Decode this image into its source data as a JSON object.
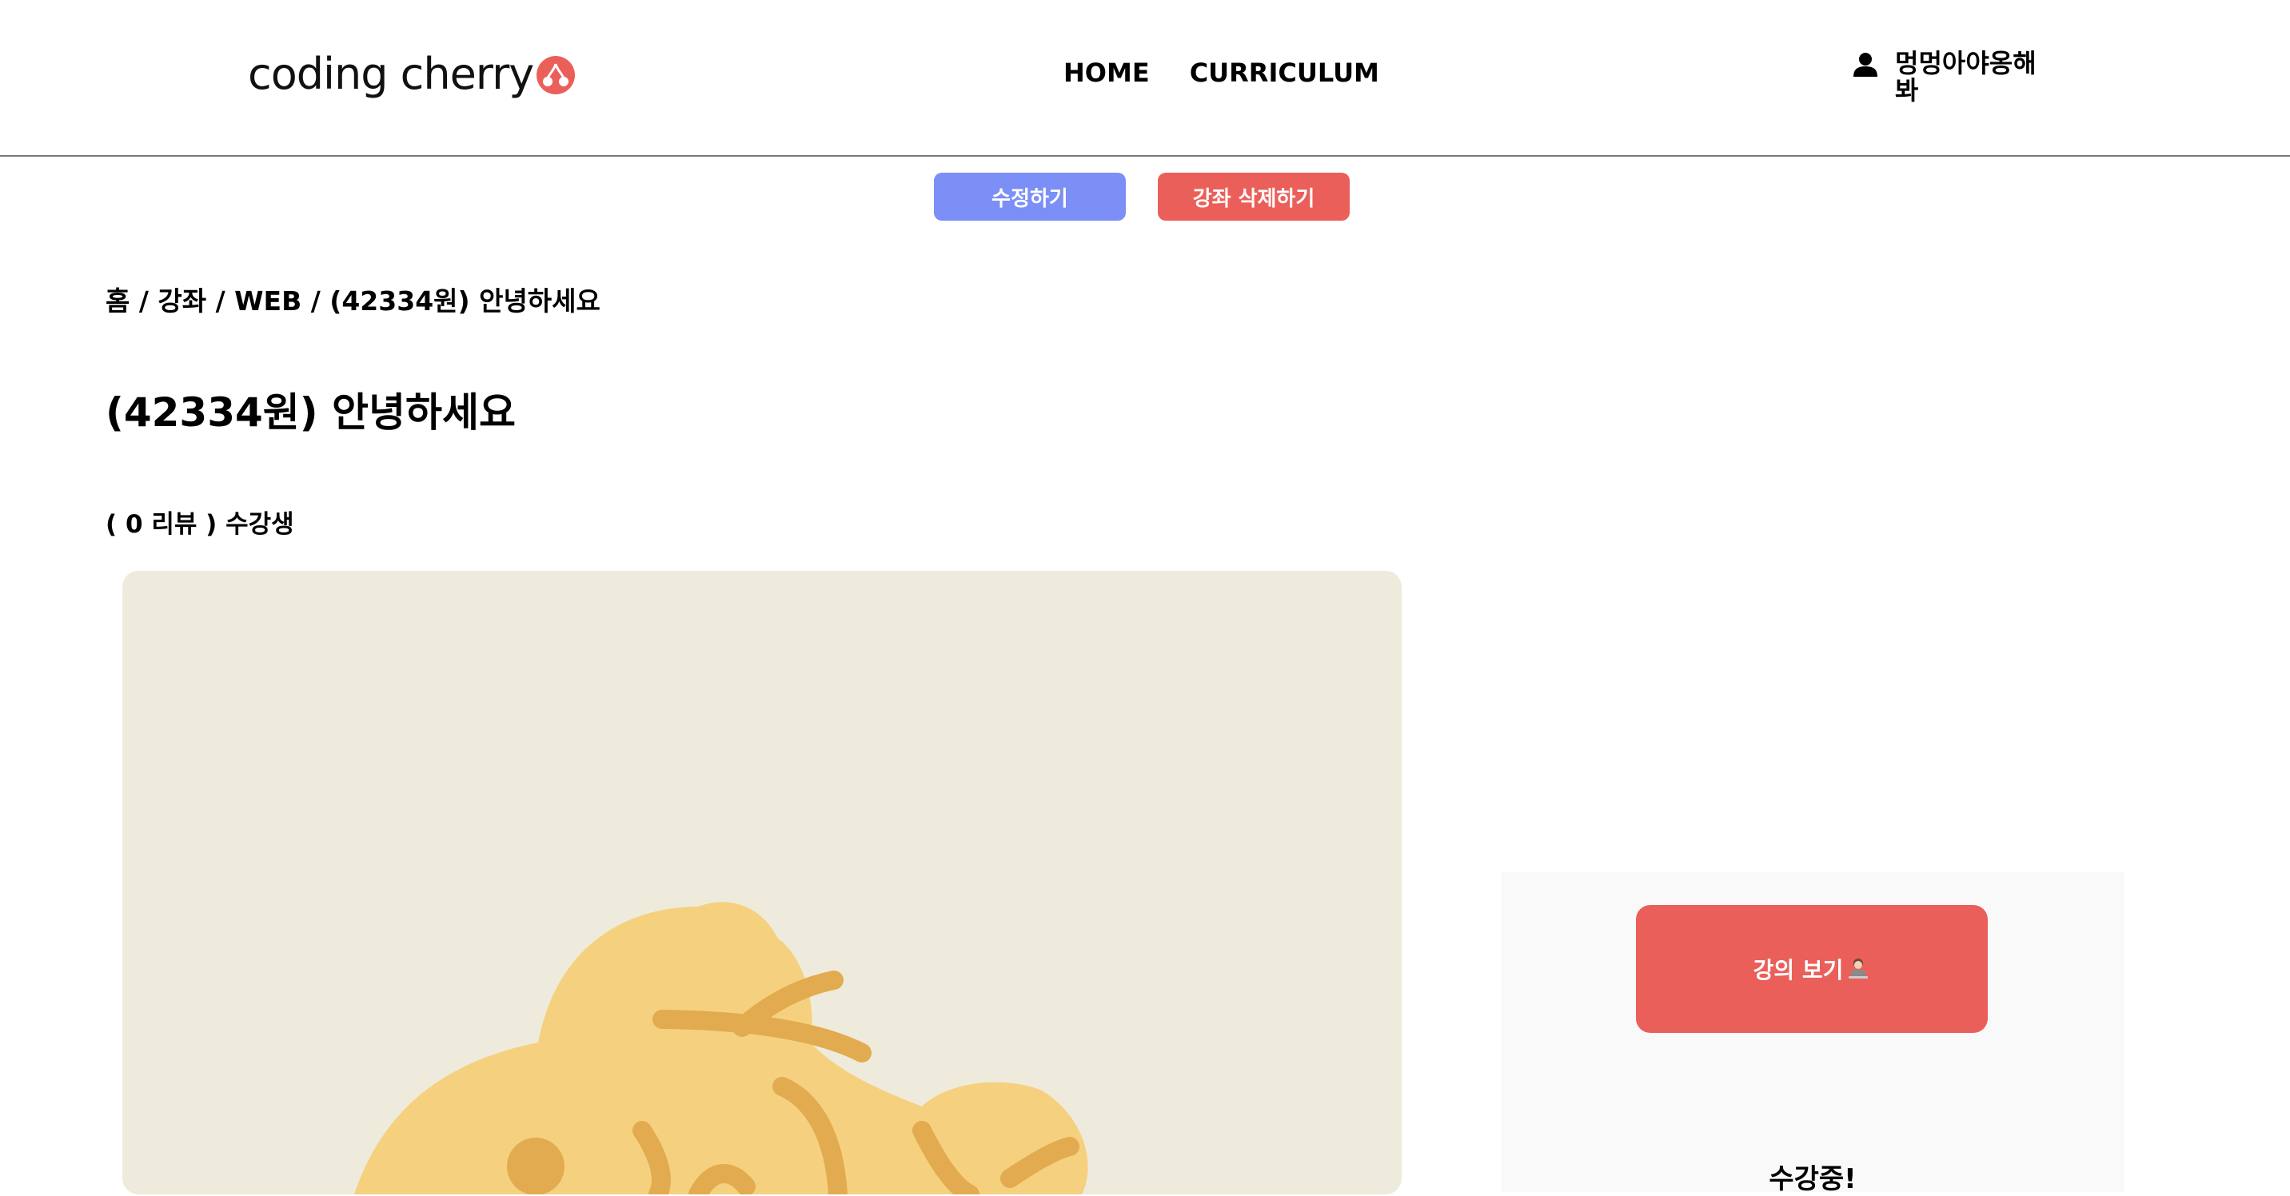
{
  "colors": {
    "brand": "#eb5f5a",
    "edit": "#7b8ff6",
    "thumbnail_bg": "#efebdc"
  },
  "header": {
    "logo_text": "coding cherry",
    "nav": [
      "HOME",
      "CURRICULUM"
    ],
    "user": {
      "icon": "user-icon",
      "name": "멍멍아야옹해봐"
    }
  },
  "admin": {
    "edit_label": "수정하기",
    "delete_label": "강좌 삭제하기"
  },
  "course": {
    "breadcrumb": "홈 / 강좌 / WEB / (42334원) 안녕하세요",
    "title": "(42334원) 안녕하세요",
    "review_line": "( 0 리뷰 ) 수강생"
  },
  "side_panel": {
    "watch_label": "강의 보기",
    "watch_icon": "person-at-laptop-icon",
    "status": "수강중!"
  }
}
